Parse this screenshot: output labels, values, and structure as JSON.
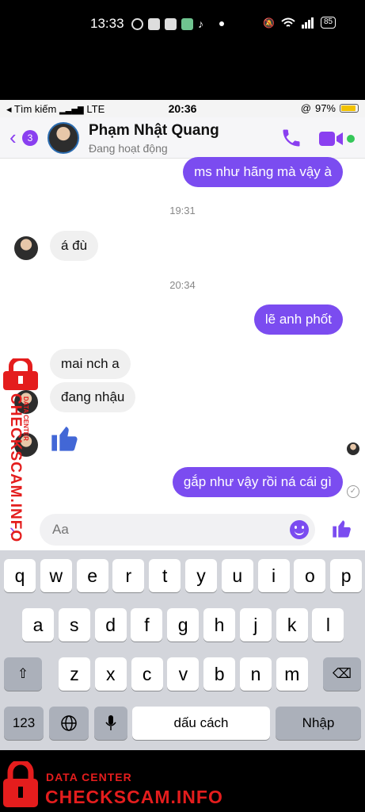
{
  "os_status": {
    "time": "13:33",
    "battery": "85"
  },
  "ios_status": {
    "carrier": "◂ Tìm kiếm",
    "network": "LTE",
    "time": "20:36",
    "battery": "97%"
  },
  "header": {
    "back_count": "3",
    "name": "Phạm Nhật Quang",
    "status": "Đang hoạt động"
  },
  "messages": {
    "m1": "ms như hãng mà vậy à",
    "t1": "19:31",
    "m2": "á đù",
    "t2": "20:34",
    "m3": "lẽ anh phốt",
    "m4": "mai nch a",
    "m5": "đang nhậu",
    "m6": "gắp như vậy rồi ná cái gì"
  },
  "composer": {
    "placeholder": "Aa"
  },
  "keyboard": {
    "row1": [
      "q",
      "w",
      "e",
      "r",
      "t",
      "y",
      "u",
      "i",
      "o",
      "p"
    ],
    "row2": [
      "a",
      "s",
      "d",
      "f",
      "g",
      "h",
      "j",
      "k",
      "l"
    ],
    "row3": [
      "z",
      "x",
      "c",
      "v",
      "b",
      "n",
      "m"
    ],
    "num": "123",
    "space": "dấu cách",
    "enter": "Nhập"
  },
  "watermark": {
    "sub": "DATA CENTER",
    "brand": "CHECKSCAM.INFO"
  },
  "colors": {
    "accent": "#7b4cf0",
    "watermark": "#e41d1d"
  }
}
